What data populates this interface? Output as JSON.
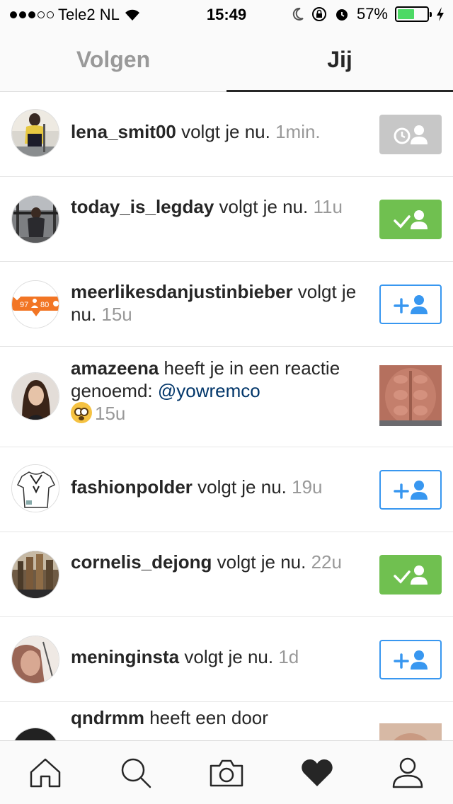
{
  "status_bar": {
    "carrier": "Tele2 NL",
    "time": "15:49",
    "battery_percent": "57%",
    "battery_level": 0.57,
    "signal_bars": 3,
    "icons": [
      "wifi-icon",
      "moon-icon",
      "rotation-lock-icon",
      "alarm-icon",
      "charging-icon"
    ]
  },
  "tabs": [
    {
      "label": "Volgen",
      "active": false
    },
    {
      "label": "Jij",
      "active": true
    }
  ],
  "notifications": [
    {
      "username": "lena_smit00",
      "text": " volgt je nu. ",
      "time": "1min.",
      "action": "pending"
    },
    {
      "username": "today_is_legday",
      "text": " volgt je nu. ",
      "time": "11u",
      "action": "following"
    },
    {
      "username": "meerlikesdanjustinbieber",
      "text": " volgt je nu. ",
      "time": "15u",
      "action": "follow",
      "avatar_badge_likes": "97",
      "avatar_badge_followers": "80"
    },
    {
      "username": "amazeena",
      "text": " heeft je in een reactie genoemd: ",
      "mention": "@yowremco",
      "time": "15u",
      "action": "thumbnail"
    },
    {
      "username": "fashionpolder",
      "text": " volgt je nu. ",
      "time": "19u",
      "action": "follow"
    },
    {
      "username": "cornelis_dejong",
      "text": " volgt je nu. ",
      "time": "22u",
      "action": "following"
    },
    {
      "username": "meninginsta",
      "text": " volgt je nu. ",
      "time": "1d",
      "action": "follow"
    },
    {
      "username": "qndrmm",
      "text": " heeft een door",
      "time": "",
      "action": "thumbnail"
    }
  ],
  "tab_bar": {
    "items": [
      "home-icon",
      "search-icon",
      "camera-icon",
      "heart-icon",
      "profile-icon"
    ],
    "active": "heart-icon"
  },
  "colors": {
    "follow_blue": "#3897f0",
    "following_green": "#70c050",
    "pending_gray": "#c7c7c7",
    "time_gray": "#999999",
    "mention_blue": "#003569"
  }
}
